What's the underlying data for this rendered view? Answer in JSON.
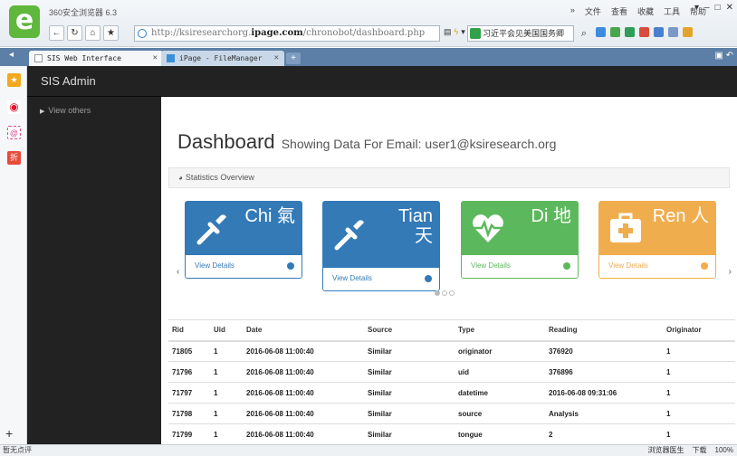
{
  "browser": {
    "app_name": "360安全浏览器 6.3",
    "menu": [
      "»",
      "文件",
      "查看",
      "收藏",
      "工具",
      "帮助"
    ],
    "window_controls": [
      "▾",
      "–",
      "□",
      "✕"
    ],
    "address_prefix": "http://",
    "address_domain_a": "ksiresearchorg.",
    "address_domain_b": "ipage.com",
    "address_path": "/chronobot/dashboard.php",
    "search_text": "习近平会见美国国务卿",
    "tabs": [
      {
        "title": "SIS Web Interface"
      },
      {
        "title": "iPage - FileManager"
      }
    ],
    "status_left": "暂无点评",
    "status_right": [
      "浏览器医生",
      "下载",
      "100%"
    ]
  },
  "app": {
    "brand": "SIS Admin",
    "sidenav_item": "View others",
    "heading": "Dashboard",
    "subheading": "Showing Data For Email: user1@ksiresearch.org",
    "panel_title": "Statistics Overview",
    "cards": [
      {
        "title_line1": "Chi 氣",
        "title_line2": "",
        "link": "View Details",
        "color": "#337ab7",
        "icon": "dropper-icon"
      },
      {
        "title_line1": "Tian",
        "title_line2": "天",
        "link": "View Details",
        "color": "#337ab7",
        "icon": "dropper-icon"
      },
      {
        "title_line1": "Di 地",
        "title_line2": "",
        "link": "View Details",
        "color": "#5cb85c",
        "icon": "heartbeat-icon"
      },
      {
        "title_line1": "Ren 人",
        "title_line2": "",
        "link": "View Details",
        "color": "#f0ad4e",
        "icon": "medkit-icon"
      }
    ],
    "table": {
      "headers": [
        "Rid",
        "Uid",
        "Date",
        "Source",
        "Type",
        "Reading",
        "Originator"
      ],
      "rows": [
        [
          "71805",
          "1",
          "2016-06-08 11:00:40",
          "Similar",
          "originator",
          "376920",
          "1"
        ],
        [
          "71796",
          "1",
          "2016-06-08 11:00:40",
          "Similar",
          "uid",
          "376896",
          "1"
        ],
        [
          "71797",
          "1",
          "2016-06-08 11:00:40",
          "Similar",
          "datetime",
          "2016-06-08 09:31:06",
          "1"
        ],
        [
          "71798",
          "1",
          "2016-06-08 11:00:40",
          "Similar",
          "source",
          "Analysis",
          "1"
        ],
        [
          "71799",
          "1",
          "2016-06-08 11:00:40",
          "Similar",
          "tongue",
          "2",
          "1"
        ]
      ]
    }
  }
}
